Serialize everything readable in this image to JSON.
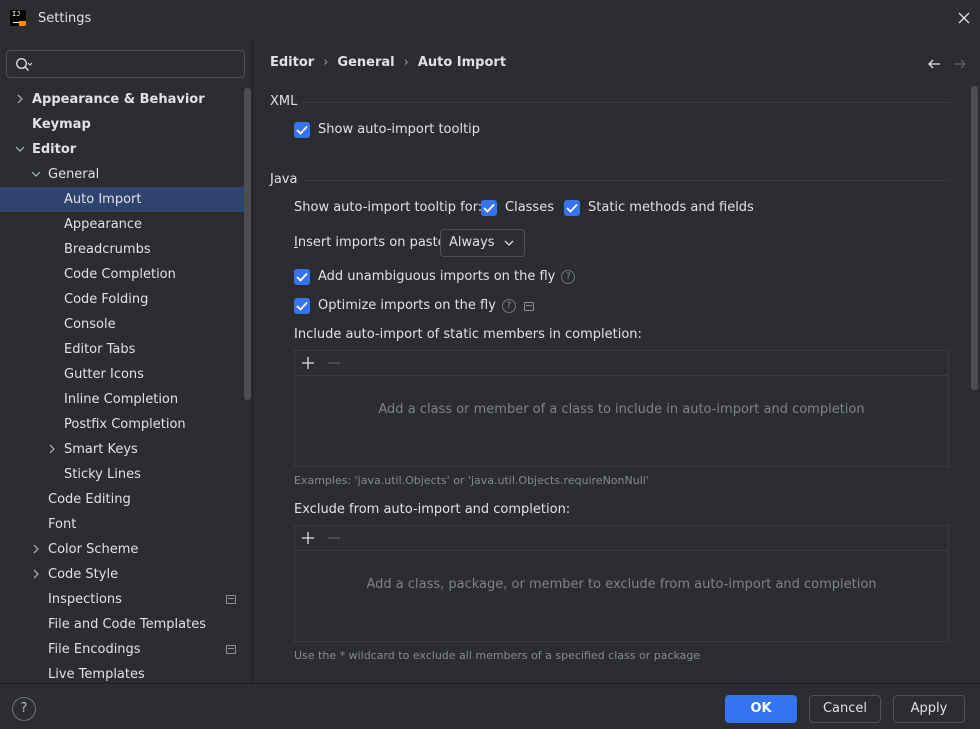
{
  "window": {
    "title": "Settings"
  },
  "search": {
    "placeholder": ""
  },
  "sidebar": {
    "items": [
      {
        "label": "Appearance & Behavior",
        "level": 0,
        "bold": true,
        "expandable": true,
        "expanded": false
      },
      {
        "label": "Keymap",
        "level": 0,
        "bold": true
      },
      {
        "label": "Editor",
        "level": 0,
        "bold": true,
        "expandable": true,
        "expanded": true
      },
      {
        "label": "General",
        "level": 1,
        "expandable": true,
        "expanded": true
      },
      {
        "label": "Auto Import",
        "level": 2,
        "selected": true
      },
      {
        "label": "Appearance",
        "level": 2
      },
      {
        "label": "Breadcrumbs",
        "level": 2
      },
      {
        "label": "Code Completion",
        "level": 2
      },
      {
        "label": "Code Folding",
        "level": 2
      },
      {
        "label": "Console",
        "level": 2
      },
      {
        "label": "Editor Tabs",
        "level": 2
      },
      {
        "label": "Gutter Icons",
        "level": 2
      },
      {
        "label": "Inline Completion",
        "level": 2
      },
      {
        "label": "Postfix Completion",
        "level": 2
      },
      {
        "label": "Smart Keys",
        "level": 2,
        "expandable": true,
        "expanded": false
      },
      {
        "label": "Sticky Lines",
        "level": 2
      },
      {
        "label": "Code Editing",
        "level": 1
      },
      {
        "label": "Font",
        "level": 1
      },
      {
        "label": "Color Scheme",
        "level": 1,
        "expandable": true,
        "expanded": false
      },
      {
        "label": "Code Style",
        "level": 1,
        "expandable": true,
        "expanded": false
      },
      {
        "label": "Inspections",
        "level": 1,
        "project_icon": true
      },
      {
        "label": "File and Code Templates",
        "level": 1
      },
      {
        "label": "File Encodings",
        "level": 1,
        "project_icon": true
      },
      {
        "label": "Live Templates",
        "level": 1
      }
    ]
  },
  "breadcrumb": {
    "items": [
      "Editor",
      "General",
      "Auto Import"
    ]
  },
  "xml": {
    "title": "XML",
    "show_tooltip": {
      "label": "Show auto-import tooltip",
      "checked": true
    }
  },
  "java": {
    "title": "Java",
    "tooltip_for_label": "Show auto-import tooltip for:",
    "classes": {
      "label": "Classes",
      "checked": true
    },
    "static_methods": {
      "label": "Static methods and fields",
      "checked": true
    },
    "insert_on_paste": {
      "label_mnemonic": "I",
      "label_rest": "nsert imports on paste:",
      "value": "Always"
    },
    "add_unambiguous": {
      "label": "Add unambiguous imports on the fly",
      "checked": true
    },
    "optimize": {
      "label": "Optimize imports on the fly",
      "checked": true
    },
    "include_static": {
      "label": "Include auto-import of static members in completion:",
      "empty_text": "Add a class or member of a class to include in auto-import and completion",
      "hint": "Examples: 'java.util.Objects' or 'java.util.Objects.requireNonNull'"
    },
    "exclude": {
      "label": "Exclude from auto-import and completion:",
      "empty_text": "Add a class, package, or member to exclude from auto-import and completion",
      "hint": "Use the * wildcard to exclude all members of a specified class or package"
    }
  },
  "footer": {
    "help": "?",
    "ok": "OK",
    "cancel": "Cancel",
    "apply": "Apply"
  },
  "colors": {
    "accent": "#3574f0",
    "selection": "#2e436e",
    "background": "#2b2d30"
  }
}
